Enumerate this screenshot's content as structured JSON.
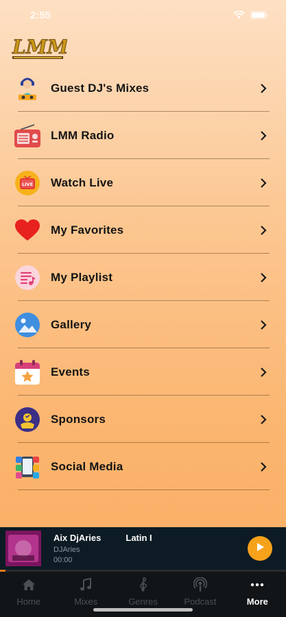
{
  "status": {
    "time": "2:55"
  },
  "menu": [
    {
      "label": "Guest DJ's Mixes",
      "icon": "dj-icon"
    },
    {
      "label": "LMM Radio",
      "icon": "radio-icon"
    },
    {
      "label": "Watch Live",
      "icon": "live-tv-icon"
    },
    {
      "label": "My Favorites",
      "icon": "heart-icon"
    },
    {
      "label": "My Playlist",
      "icon": "playlist-icon"
    },
    {
      "label": "Gallery",
      "icon": "gallery-icon"
    },
    {
      "label": "Events",
      "icon": "calendar-icon"
    },
    {
      "label": "Sponsors",
      "icon": "sponsor-icon"
    },
    {
      "label": "Social Media",
      "icon": "social-apps-icon"
    }
  ],
  "player": {
    "title": "Aix DjAries",
    "genre": "Latin I",
    "artist": "DJAries",
    "time": "00:00",
    "progress_fraction": 0.02
  },
  "tabs": [
    {
      "label": "Home",
      "icon": "home-icon",
      "active": false
    },
    {
      "label": "Mixes",
      "icon": "music-note-icon",
      "active": false
    },
    {
      "label": "Genres",
      "icon": "treble-clef-icon",
      "active": false
    },
    {
      "label": "Podcast",
      "icon": "podcast-icon",
      "active": false
    },
    {
      "label": "More",
      "icon": "more-dots-icon",
      "active": true
    }
  ],
  "colors": {
    "accent": "#f7a21b",
    "player_bg": "#0d1b24",
    "tabbar_bg": "#111518"
  }
}
